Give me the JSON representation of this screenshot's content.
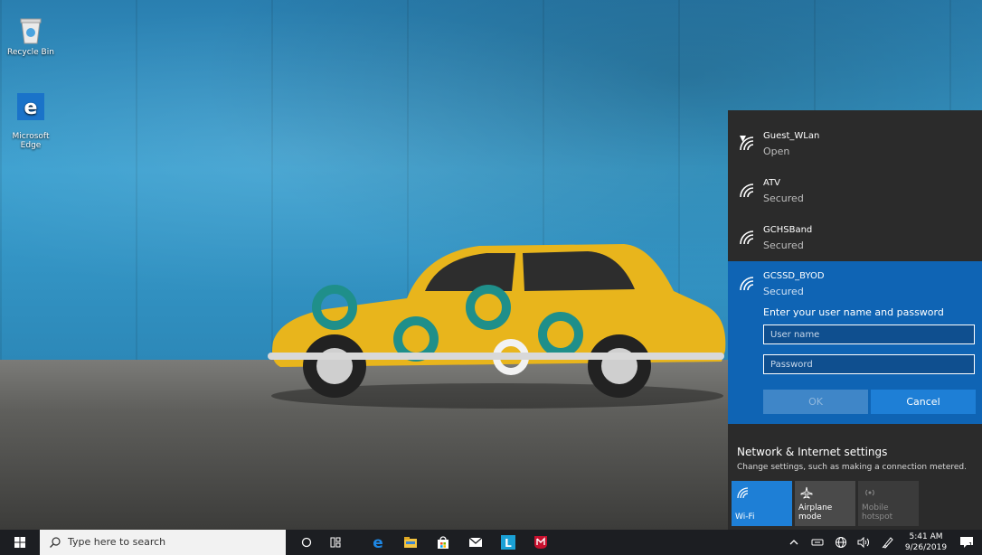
{
  "desktop": {
    "icons": [
      {
        "label": "Recycle Bin",
        "icon": "recycle-bin-icon"
      },
      {
        "label": "Microsoft\nEdge",
        "icon": "edge-icon"
      }
    ]
  },
  "wifi_flyout": {
    "networks": [
      {
        "name": "Guest_WLan",
        "status": "Open",
        "icon": "wifi-warning-icon"
      },
      {
        "name": "ATV",
        "status": "Secured",
        "icon": "wifi-secured-icon"
      },
      {
        "name": "GCHSBand",
        "status": "Secured",
        "icon": "wifi-secured-icon"
      }
    ],
    "selected": {
      "name": "GCSSD_BYOD",
      "status": "Secured",
      "prompt": "Enter your user name and password",
      "username_placeholder": "User name",
      "password_placeholder": "Password",
      "ok_label": "OK",
      "cancel_label": "Cancel"
    },
    "settings": {
      "title": "Network & Internet settings",
      "subtitle": "Change settings, such as making a connection metered."
    },
    "quick_actions": [
      {
        "label": "Wi-Fi",
        "state": "on",
        "icon": "wifi-icon"
      },
      {
        "label": "Airplane mode",
        "state": "off",
        "icon": "airplane-icon"
      },
      {
        "label": "Mobile\nhotspot",
        "state": "disabled",
        "icon": "hotspot-icon"
      }
    ],
    "colors": {
      "panel": "#2b2b2b",
      "selected": "#0f64b4",
      "accent": "#1e7fd6"
    }
  },
  "taskbar": {
    "search_placeholder": "Type here to search",
    "pinned": [
      "cortana-icon",
      "task-view-icon",
      "edge-icon",
      "file-explorer-icon",
      "store-icon",
      "mail-icon",
      "app-l-icon",
      "mcafee-icon"
    ],
    "clock": {
      "time": "5:41 AM",
      "date": "9/26/2019"
    },
    "notification_count": "1"
  }
}
